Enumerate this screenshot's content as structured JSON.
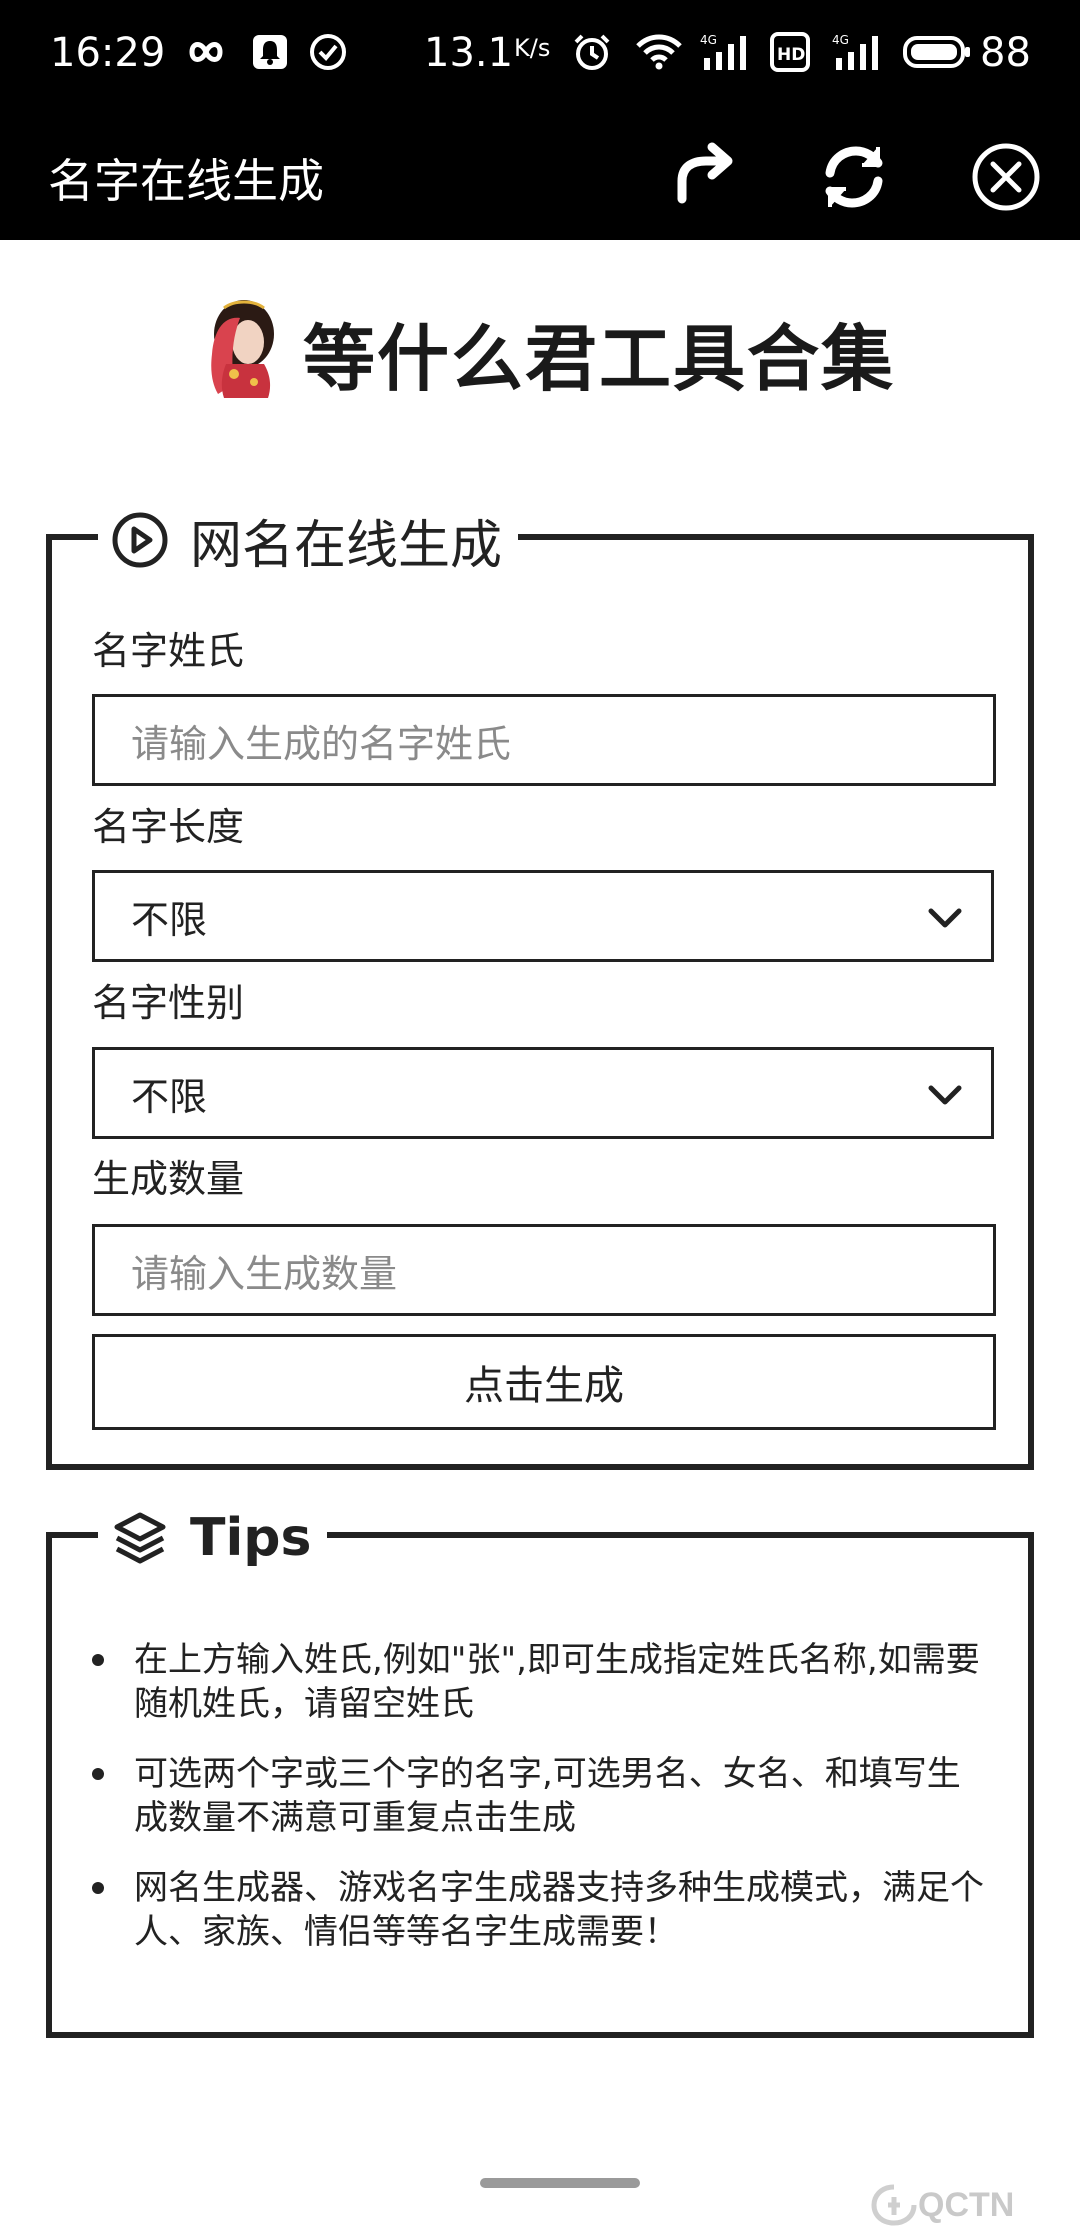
{
  "status_bar": {
    "time": "16:29",
    "speed": "13.1",
    "speed_unit": "K/s",
    "battery": "88",
    "icons": [
      "infinity-icon",
      "notification-icon",
      "check-circle-icon",
      "alarm-icon",
      "wifi-icon",
      "signal-4g-icon",
      "hd-icon",
      "signal-4g-icon",
      "battery-icon"
    ]
  },
  "toolbar": {
    "title": "名字在线生成",
    "buttons": [
      "share-icon",
      "refresh-icon",
      "close-icon"
    ]
  },
  "header": {
    "site_title": "等什么君工具合集"
  },
  "generator": {
    "legend": "网名在线生成",
    "surname_label": "名字姓氏",
    "surname_placeholder": "请输入生成的名字姓氏",
    "length_label": "名字长度",
    "length_value": "不限",
    "gender_label": "名字性别",
    "gender_value": "不限",
    "count_label": "生成数量",
    "count_placeholder": "请输入生成数量",
    "submit_label": "点击生成"
  },
  "tips": {
    "legend": "Tips",
    "items": [
      "在上方输入姓氏,例如\"张\",即可生成指定姓氏名称,如需要随机姓氏，请留空姓氏",
      "可选两个字或三个字的名字,可选男名、女名、和填写生成数量不满意可重复点击生成",
      "网名生成器、游戏名字生成器支持多种生成模式，满足个人、家族、情侣等等名字生成需要！"
    ]
  },
  "watermark": "QCTN"
}
